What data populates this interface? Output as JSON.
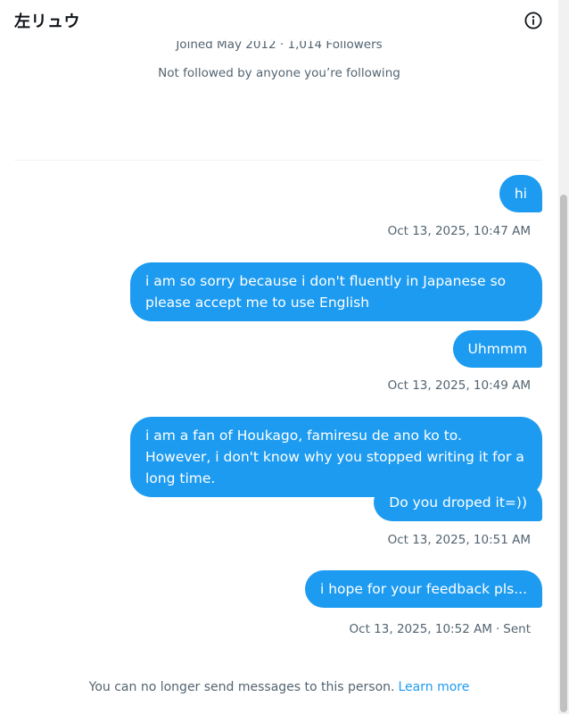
{
  "header": {
    "title": "左リュウ",
    "info_icon": "info-circle-icon"
  },
  "profile": {
    "joined_followers": "Joined May 2012 · 1,014 Followers",
    "followed_by": "Not followed by anyone you’re following"
  },
  "messages": [
    {
      "text": "hi"
    },
    {
      "text": "i am so sorry because i don't fluently in Japanese so please accept me to use English"
    },
    {
      "text": "Uhmmm"
    },
    {
      "text": "i am a fan of Houkago, famiresu de ano ko to. However, i don't know why you stopped writing it for a long time."
    },
    {
      "text": "Do you droped it=))"
    },
    {
      "text": "i hope for your feedback pls..."
    }
  ],
  "timestamps": [
    "Oct 13, 2025, 10:47 AM",
    "Oct 13, 2025, 10:49 AM",
    "Oct 13, 2025, 10:51 AM",
    "Oct 13, 2025, 10:52 AM"
  ],
  "sent_status": "Sent",
  "footer": {
    "notice": "You can no longer send messages to this person.",
    "link": "Learn more"
  },
  "colors": {
    "accent": "#1d9bf0",
    "secondary_text": "#536471"
  }
}
